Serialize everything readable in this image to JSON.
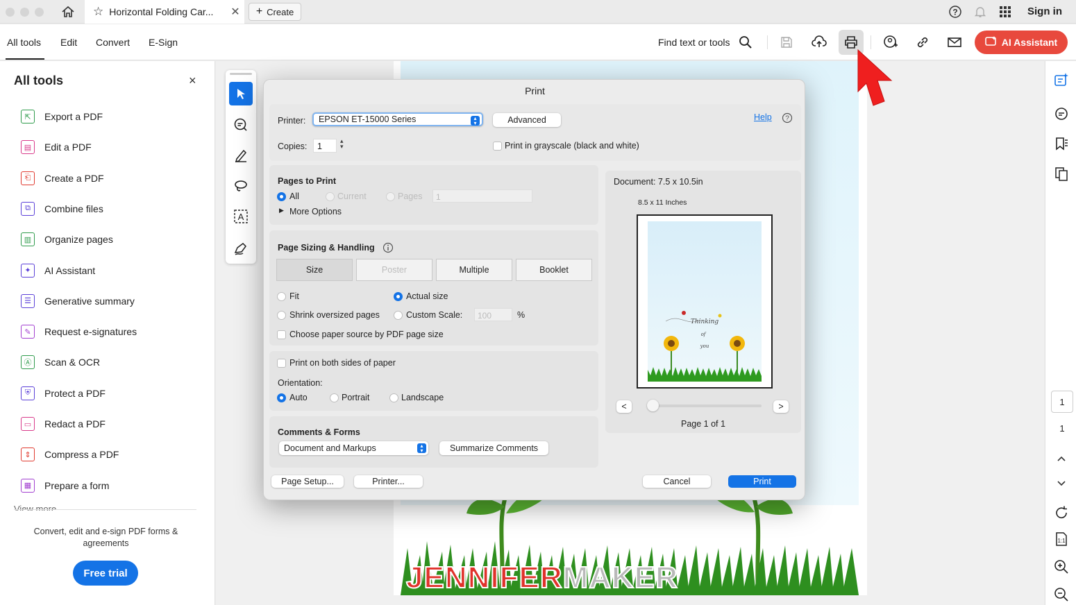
{
  "browser": {
    "tab_title": "Horizontal Folding Car...",
    "create_label": "Create",
    "sign_in": "Sign in"
  },
  "toolbar": {
    "menu": [
      "All tools",
      "Edit",
      "Convert",
      "E-Sign"
    ],
    "find_text": "Find text or tools",
    "ai_assistant": "AI Assistant"
  },
  "left_panel": {
    "title": "All tools",
    "items": [
      {
        "label": "Export a PDF",
        "icon": "export-pdf-icon",
        "color": "#2e9b4b"
      },
      {
        "label": "Edit a PDF",
        "icon": "edit-pdf-icon",
        "color": "#d93a8a"
      },
      {
        "label": "Create a PDF",
        "icon": "create-pdf-icon",
        "color": "#e03a2f"
      },
      {
        "label": "Combine files",
        "icon": "combine-files-icon",
        "color": "#5a3fd8"
      },
      {
        "label": "Organize pages",
        "icon": "organize-pages-icon",
        "color": "#2e9b4b"
      },
      {
        "label": "AI Assistant",
        "icon": "ai-assistant-icon",
        "color": "#5a3fd8"
      },
      {
        "label": "Generative summary",
        "icon": "generative-summary-icon",
        "color": "#5a3fd8"
      },
      {
        "label": "Request e-signatures",
        "icon": "request-esignatures-icon",
        "color": "#a23fd0"
      },
      {
        "label": "Scan & OCR",
        "icon": "scan-ocr-icon",
        "color": "#2e9b4b"
      },
      {
        "label": "Protect a PDF",
        "icon": "protect-pdf-icon",
        "color": "#5a3fd8"
      },
      {
        "label": "Redact a PDF",
        "icon": "redact-pdf-icon",
        "color": "#d93a8a"
      },
      {
        "label": "Compress a PDF",
        "icon": "compress-pdf-icon",
        "color": "#e03a2f"
      },
      {
        "label": "Prepare a form",
        "icon": "prepare-form-icon",
        "color": "#a23fd0"
      }
    ],
    "view_more": "View more",
    "promo": "Convert, edit and e-sign PDF forms & agreements",
    "free_trial": "Free trial"
  },
  "right_rail": {
    "current_page": "1",
    "total_pages": "1"
  },
  "document": {
    "watermark_a": "JENNIFER",
    "watermark_b": "MAKER"
  },
  "print_dialog": {
    "title": "Print",
    "printer_label": "Printer:",
    "printer_value": "EPSON ET-15000 Series",
    "advanced": "Advanced",
    "help": "Help",
    "copies_label": "Copies:",
    "copies_value": "1",
    "grayscale": "Print in grayscale (black and white)",
    "pages_to_print": {
      "title": "Pages to Print",
      "all": "All",
      "current": "Current",
      "pages": "Pages",
      "pages_value": "1",
      "more_options": "More Options"
    },
    "page_sizing": {
      "title": "Page Sizing & Handling",
      "tabs": [
        "Size",
        "Poster",
        "Multiple",
        "Booklet"
      ],
      "fit": "Fit",
      "actual_size": "Actual size",
      "shrink": "Shrink oversized pages",
      "custom_scale": "Custom Scale:",
      "scale_value": "100",
      "percent": "%",
      "paper_source": "Choose paper source by PDF page size"
    },
    "duplex": "Print on both sides of paper",
    "orientation": {
      "label": "Orientation:",
      "auto": "Auto",
      "portrait": "Portrait",
      "landscape": "Landscape"
    },
    "comments_forms": {
      "title": "Comments & Forms",
      "value": "Document and Markups",
      "summarize": "Summarize Comments"
    },
    "preview": {
      "document_size": "Document: 7.5 x 10.5in",
      "paper_size": "8.5 x 11 Inches",
      "card_text_1": "Thinking",
      "card_text_2": "of",
      "card_text_3": "you",
      "prev": "<",
      "next": ">",
      "page_label": "Page 1 of 1"
    },
    "page_setup": "Page Setup...",
    "printer_btn": "Printer...",
    "cancel": "Cancel",
    "print": "Print"
  }
}
